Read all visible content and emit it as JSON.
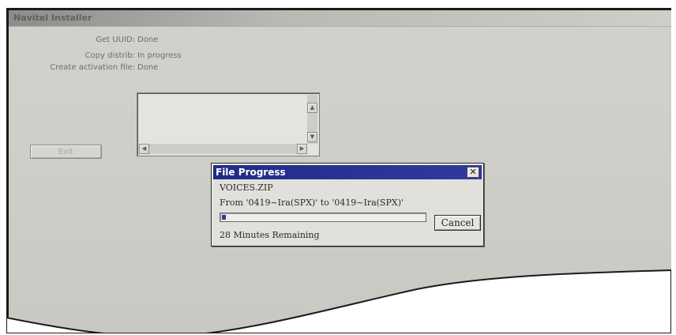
{
  "window": {
    "title": "Navitel Installer"
  },
  "status": [
    {
      "label": "Get UUID:",
      "value": "Done"
    },
    {
      "label": "Copy distrib:",
      "value": "In progress"
    },
    {
      "label": "Create activation file:",
      "value": "Done"
    }
  ],
  "buttons": {
    "exit_label": "Exit"
  },
  "scrollbar": {
    "up_glyph": "▲",
    "down_glyph": "▼",
    "left_glyph": "◀",
    "right_glyph": "▶"
  },
  "dialog": {
    "title": "File Progress",
    "close_glyph": "✕",
    "filename": "VOICES.ZIP",
    "from_to": "From '0419~Ira(SPX)' to '0419~Ira(SPX)'",
    "progress_fraction": 0.02,
    "remaining": "28 Minutes Remaining",
    "cancel_label": "Cancel"
  },
  "colors": {
    "dialog_title_bg": "#1f2c86",
    "progress_fill": "#2d3993"
  },
  "icons": [
    "close-icon",
    "scroll-up-icon",
    "scroll-down-icon",
    "scroll-left-icon",
    "scroll-right-icon"
  ]
}
